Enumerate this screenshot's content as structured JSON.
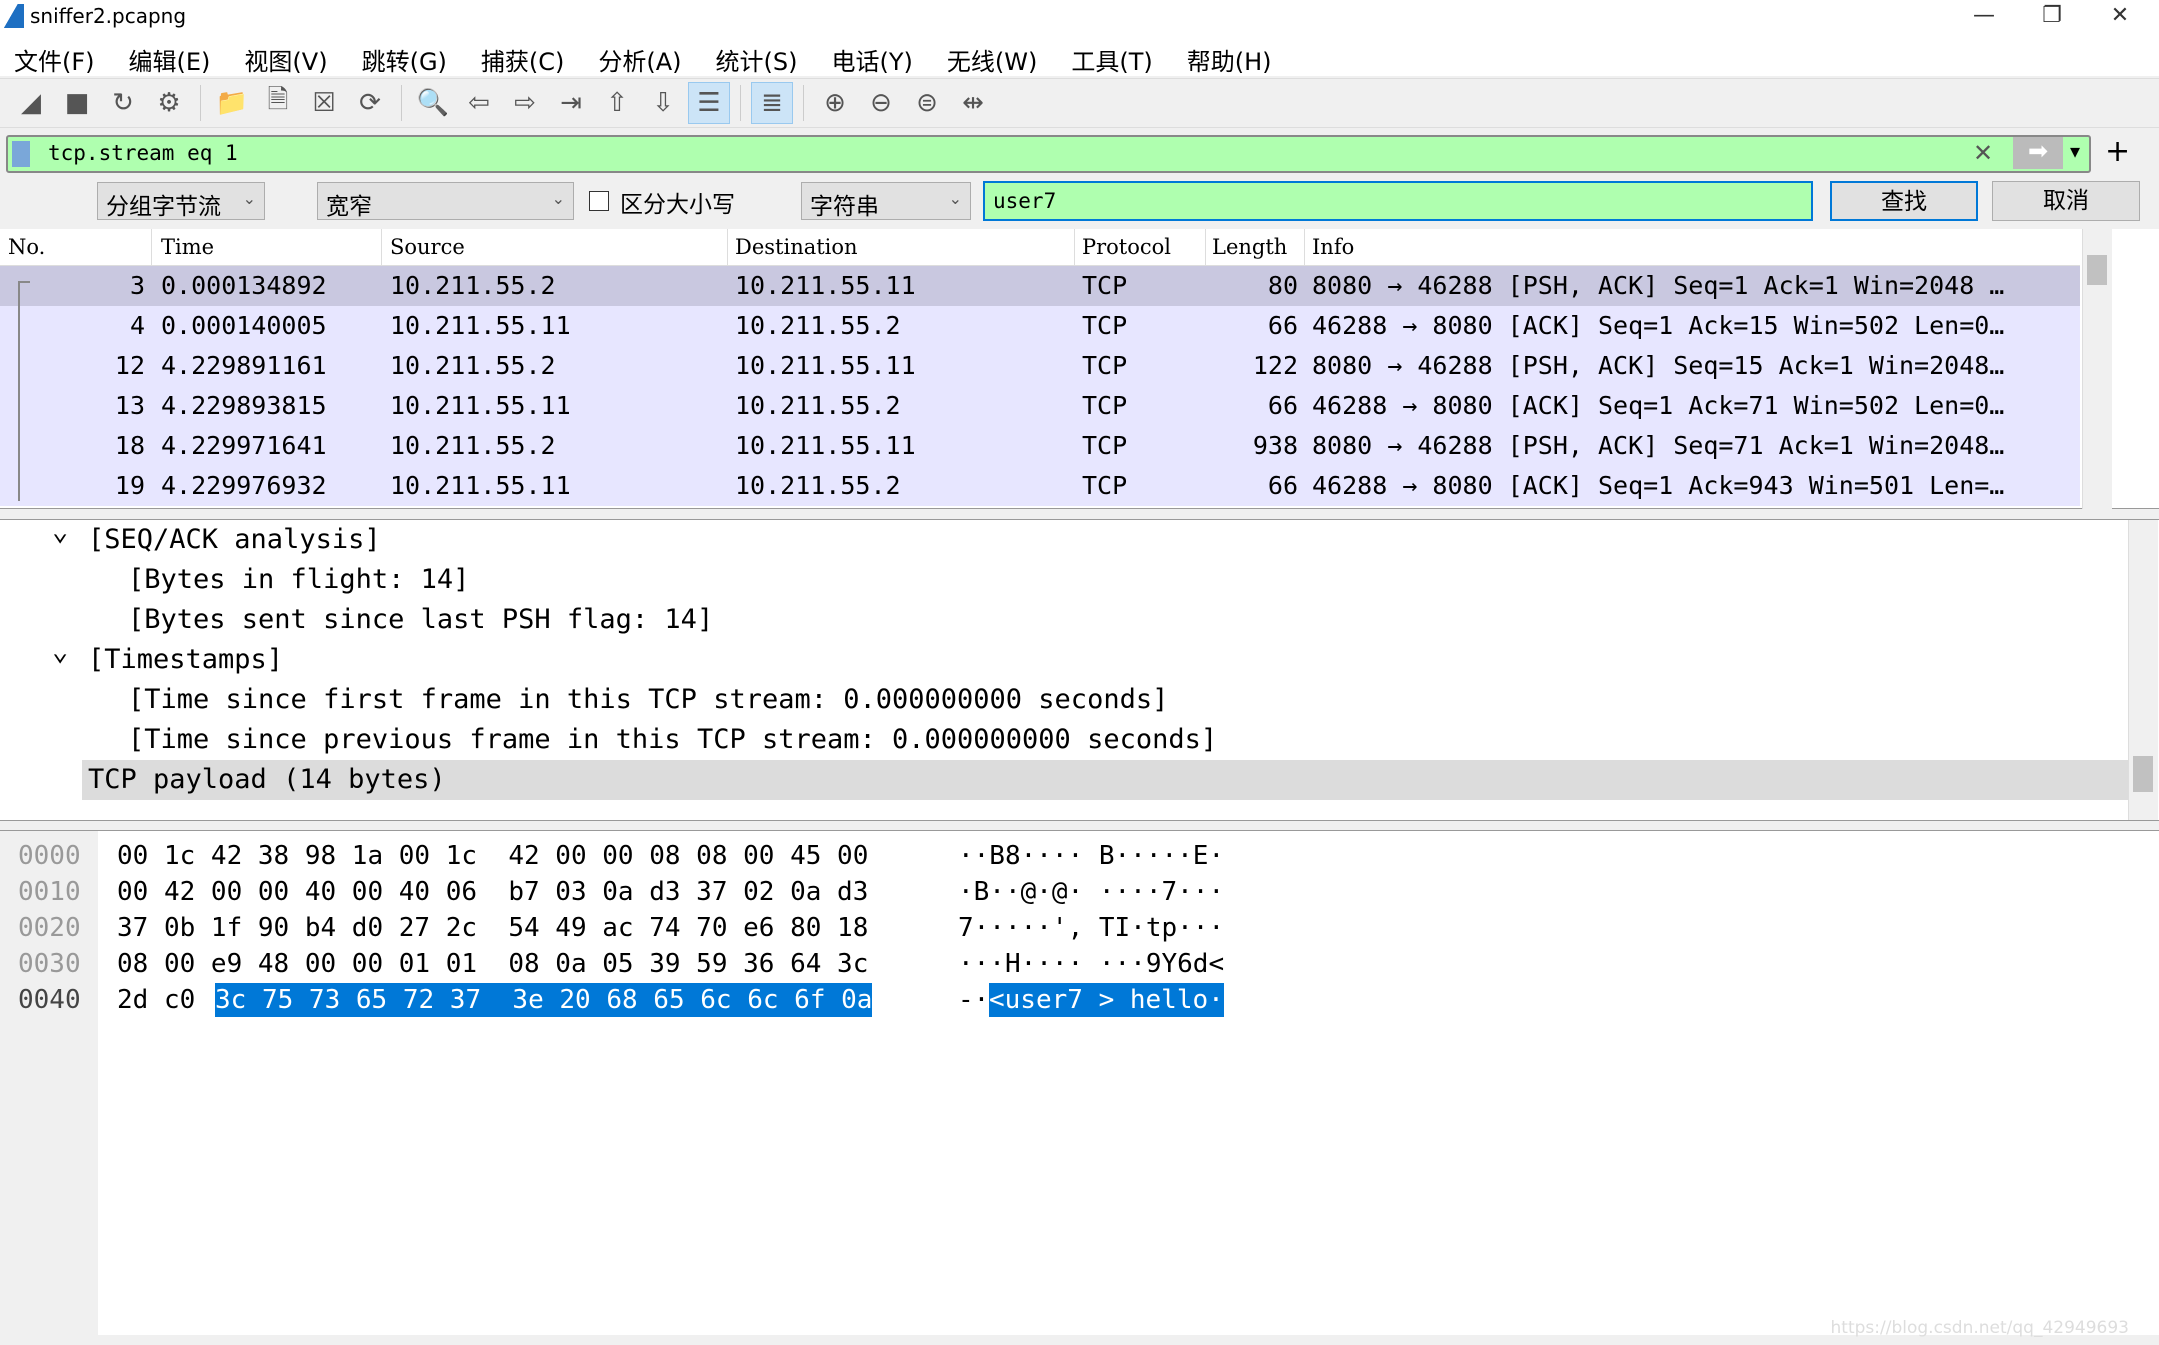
{
  "window": {
    "title": "sniffer2.pcapng",
    "minimize": "—",
    "restore": "❐",
    "close": "✕"
  },
  "menu": [
    "文件(F)",
    "编辑(E)",
    "视图(V)",
    "跳转(G)",
    "捕获(C)",
    "分析(A)",
    "统计(S)",
    "电话(Y)",
    "无线(W)",
    "工具(T)",
    "帮助(H)"
  ],
  "toolbar": [
    {
      "icon": "shark-fin-start-icon",
      "glyph": "◢"
    },
    {
      "icon": "stop-icon",
      "glyph": "■"
    },
    {
      "icon": "restart-icon",
      "glyph": "↻"
    },
    {
      "icon": "capture-options-icon",
      "glyph": "⚙"
    },
    "sep",
    {
      "icon": "open-folder-icon",
      "glyph": "📁"
    },
    {
      "icon": "save-file-icon",
      "glyph": "🗎"
    },
    {
      "icon": "close-file-icon",
      "glyph": "☒"
    },
    {
      "icon": "reload-icon",
      "glyph": "⟳"
    },
    "sep",
    {
      "icon": "find-icon",
      "glyph": "🔍"
    },
    {
      "icon": "back-icon",
      "glyph": "⇦"
    },
    {
      "icon": "forward-icon",
      "glyph": "⇨"
    },
    {
      "icon": "go-to-packet-icon",
      "glyph": "⇥"
    },
    {
      "icon": "first-packet-icon",
      "glyph": "⇧"
    },
    {
      "icon": "last-packet-icon",
      "glyph": "⇩"
    },
    {
      "icon": "autoscroll-icon",
      "glyph": "☰",
      "on": true
    },
    "sep",
    {
      "icon": "colorize-icon",
      "glyph": "≣",
      "on": true
    },
    "sep",
    {
      "icon": "zoom-in-icon",
      "glyph": "⊕"
    },
    {
      "icon": "zoom-out-icon",
      "glyph": "⊖"
    },
    {
      "icon": "zoom-reset-icon",
      "glyph": "⊜"
    },
    {
      "icon": "resize-columns-icon",
      "glyph": "⇹"
    }
  ],
  "filter": {
    "value": "tcp.stream eq 1",
    "clear": "✕",
    "apply": "➡",
    "dropdown": "▾",
    "add": "+"
  },
  "search": {
    "scope": "分组字节流",
    "charset": "宽窄",
    "case_label": "区分大小写",
    "type": "字符串",
    "value": "user7",
    "find": "查找",
    "cancel": "取消"
  },
  "packet_list": {
    "columns": [
      "No.",
      "Time",
      "Source",
      "Destination",
      "Protocol",
      "Length",
      "Info"
    ],
    "rows": [
      [
        "3",
        "0.000134892",
        "10.211.55.2",
        "10.211.55.11",
        "TCP",
        "80",
        "8080 → 46288 [PSH, ACK] Seq=1 Ack=1 Win=2048 …"
      ],
      [
        "4",
        "0.000140005",
        "10.211.55.11",
        "10.211.55.2",
        "TCP",
        "66",
        "46288 → 8080 [ACK] Seq=1 Ack=15 Win=502 Len=0…"
      ],
      [
        "12",
        "4.229891161",
        "10.211.55.2",
        "10.211.55.11",
        "TCP",
        "122",
        "8080 → 46288 [PSH, ACK] Seq=15 Ack=1 Win=2048…"
      ],
      [
        "13",
        "4.229893815",
        "10.211.55.11",
        "10.211.55.2",
        "TCP",
        "66",
        "46288 → 8080 [ACK] Seq=1 Ack=71 Win=502 Len=0…"
      ],
      [
        "18",
        "4.229971641",
        "10.211.55.2",
        "10.211.55.11",
        "TCP",
        "938",
        "8080 → 46288 [PSH, ACK] Seq=71 Ack=1 Win=2048…"
      ],
      [
        "19",
        "4.229976932",
        "10.211.55.11",
        "10.211.55.2",
        "TCP",
        "66",
        "46288 → 8080 [ACK] Seq=1 Ack=943 Win=501 Len=…"
      ]
    ]
  },
  "details": [
    {
      "indent": 1,
      "expander": "⌄",
      "text": "[SEQ/ACK analysis]"
    },
    {
      "indent": 2,
      "text": "[Bytes in flight: 14]"
    },
    {
      "indent": 2,
      "text": "[Bytes sent since last PSH flag: 14]"
    },
    {
      "indent": 1,
      "expander": "⌄",
      "text": "[Timestamps]"
    },
    {
      "indent": 2,
      "text": "[Time since first frame in this TCP stream: 0.000000000 seconds]"
    },
    {
      "indent": 2,
      "text": "[Time since previous frame in this TCP stream: 0.000000000 seconds]"
    },
    {
      "indent": 1,
      "text": "TCP payload (14 bytes)",
      "selected": true
    }
  ],
  "hex": [
    {
      "off": "0000",
      "hex": "00 1c 42 38 98 1a 00 1c  42 00 00 08 08 00 45 00",
      "ascii": "··B8···· B·····E·"
    },
    {
      "off": "0010",
      "hex": "00 42 00 00 40 00 40 06  b7 03 0a d3 37 02 0a d3",
      "ascii": "·B··@·@· ····7···"
    },
    {
      "off": "0020",
      "hex": "37 0b 1f 90 b4 d0 27 2c  54 49 ac 74 70 e6 80 18",
      "ascii": "7·····', TI·tp···"
    },
    {
      "off": "0030",
      "hex": "08 00 e9 48 00 00 01 01  08 0a 05 39 59 36 64 3c",
      "ascii": "···H···· ···9Y6d<"
    },
    {
      "off": "0040",
      "hex_plain": "2d c0 ",
      "hex_sel": "3c 75 73 65 72 37  3e 20 68 65 6c 6c 6f 0a",
      "ascii_plain": "-·",
      "ascii_sel": "<user7 > hello·"
    }
  ],
  "watermark": "https://blog.csdn.net/qq_42949693"
}
